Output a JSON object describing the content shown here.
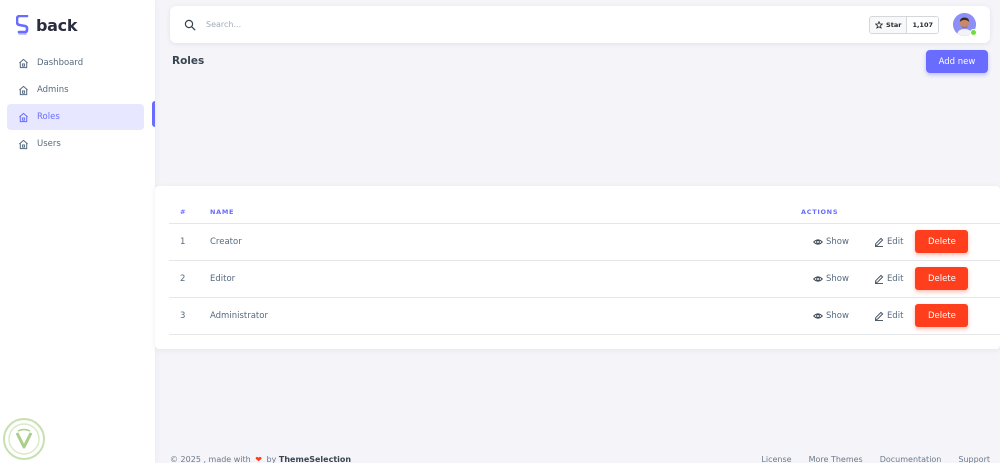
{
  "brand": {
    "name": "back",
    "accent": "#696cff"
  },
  "sidebar": {
    "items": [
      {
        "label": "Dashboard",
        "icon": "home-icon",
        "active": false
      },
      {
        "label": "Admins",
        "icon": "home-icon",
        "active": false
      },
      {
        "label": "Roles",
        "icon": "home-icon",
        "active": true
      },
      {
        "label": "Users",
        "icon": "home-icon",
        "active": false
      }
    ]
  },
  "navbar": {
    "search": {
      "placeholder": "Search...",
      "value": ""
    },
    "github": {
      "star_label": "Star",
      "star_count": "1,107"
    },
    "avatar": {
      "status": "online"
    }
  },
  "page": {
    "title": "Roles",
    "add_new_label": "Add new"
  },
  "table": {
    "headers": {
      "id": "#",
      "name": "NAME",
      "actions": "ACTIONS"
    },
    "rows": [
      {
        "id": "1",
        "name": "Creator"
      },
      {
        "id": "2",
        "name": "Editor"
      },
      {
        "id": "3",
        "name": "Administrator"
      }
    ],
    "actions": {
      "show": "Show",
      "edit": "Edit",
      "delete": "Delete"
    }
  },
  "footer": {
    "copyright": "© 2025 , made with",
    "by": "by",
    "company": "ThemeSelection",
    "links": [
      "License",
      "More Themes",
      "Documentation",
      "Support"
    ]
  },
  "colors": {
    "primary": "#696cff",
    "danger": "#ff3e1d",
    "background": "#f5f5f9",
    "status_online": "#71dd37"
  }
}
